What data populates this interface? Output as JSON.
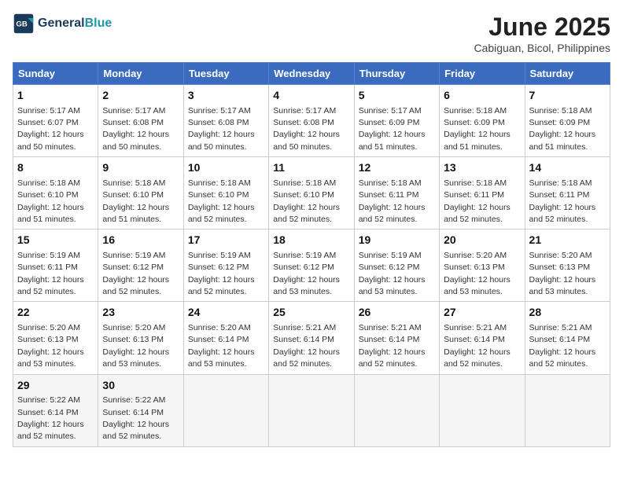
{
  "header": {
    "logo_line1": "General",
    "logo_line2": "Blue",
    "month_year": "June 2025",
    "location": "Cabiguan, Bicol, Philippines"
  },
  "weekdays": [
    "Sunday",
    "Monday",
    "Tuesday",
    "Wednesday",
    "Thursday",
    "Friday",
    "Saturday"
  ],
  "weeks": [
    [
      {
        "day": 1,
        "sunrise": "5:17 AM",
        "sunset": "6:07 PM",
        "daylight": "12 hours and 50 minutes."
      },
      {
        "day": 2,
        "sunrise": "5:17 AM",
        "sunset": "6:08 PM",
        "daylight": "12 hours and 50 minutes."
      },
      {
        "day": 3,
        "sunrise": "5:17 AM",
        "sunset": "6:08 PM",
        "daylight": "12 hours and 50 minutes."
      },
      {
        "day": 4,
        "sunrise": "5:17 AM",
        "sunset": "6:08 PM",
        "daylight": "12 hours and 50 minutes."
      },
      {
        "day": 5,
        "sunrise": "5:17 AM",
        "sunset": "6:09 PM",
        "daylight": "12 hours and 51 minutes."
      },
      {
        "day": 6,
        "sunrise": "5:18 AM",
        "sunset": "6:09 PM",
        "daylight": "12 hours and 51 minutes."
      },
      {
        "day": 7,
        "sunrise": "5:18 AM",
        "sunset": "6:09 PM",
        "daylight": "12 hours and 51 minutes."
      }
    ],
    [
      {
        "day": 8,
        "sunrise": "5:18 AM",
        "sunset": "6:10 PM",
        "daylight": "12 hours and 51 minutes."
      },
      {
        "day": 9,
        "sunrise": "5:18 AM",
        "sunset": "6:10 PM",
        "daylight": "12 hours and 51 minutes."
      },
      {
        "day": 10,
        "sunrise": "5:18 AM",
        "sunset": "6:10 PM",
        "daylight": "12 hours and 52 minutes."
      },
      {
        "day": 11,
        "sunrise": "5:18 AM",
        "sunset": "6:10 PM",
        "daylight": "12 hours and 52 minutes."
      },
      {
        "day": 12,
        "sunrise": "5:18 AM",
        "sunset": "6:11 PM",
        "daylight": "12 hours and 52 minutes."
      },
      {
        "day": 13,
        "sunrise": "5:18 AM",
        "sunset": "6:11 PM",
        "daylight": "12 hours and 52 minutes."
      },
      {
        "day": 14,
        "sunrise": "5:18 AM",
        "sunset": "6:11 PM",
        "daylight": "12 hours and 52 minutes."
      }
    ],
    [
      {
        "day": 15,
        "sunrise": "5:19 AM",
        "sunset": "6:11 PM",
        "daylight": "12 hours and 52 minutes."
      },
      {
        "day": 16,
        "sunrise": "5:19 AM",
        "sunset": "6:12 PM",
        "daylight": "12 hours and 52 minutes."
      },
      {
        "day": 17,
        "sunrise": "5:19 AM",
        "sunset": "6:12 PM",
        "daylight": "12 hours and 52 minutes."
      },
      {
        "day": 18,
        "sunrise": "5:19 AM",
        "sunset": "6:12 PM",
        "daylight": "12 hours and 53 minutes."
      },
      {
        "day": 19,
        "sunrise": "5:19 AM",
        "sunset": "6:12 PM",
        "daylight": "12 hours and 53 minutes."
      },
      {
        "day": 20,
        "sunrise": "5:20 AM",
        "sunset": "6:13 PM",
        "daylight": "12 hours and 53 minutes."
      },
      {
        "day": 21,
        "sunrise": "5:20 AM",
        "sunset": "6:13 PM",
        "daylight": "12 hours and 53 minutes."
      }
    ],
    [
      {
        "day": 22,
        "sunrise": "5:20 AM",
        "sunset": "6:13 PM",
        "daylight": "12 hours and 53 minutes."
      },
      {
        "day": 23,
        "sunrise": "5:20 AM",
        "sunset": "6:13 PM",
        "daylight": "12 hours and 53 minutes."
      },
      {
        "day": 24,
        "sunrise": "5:20 AM",
        "sunset": "6:14 PM",
        "daylight": "12 hours and 53 minutes."
      },
      {
        "day": 25,
        "sunrise": "5:21 AM",
        "sunset": "6:14 PM",
        "daylight": "12 hours and 52 minutes."
      },
      {
        "day": 26,
        "sunrise": "5:21 AM",
        "sunset": "6:14 PM",
        "daylight": "12 hours and 52 minutes."
      },
      {
        "day": 27,
        "sunrise": "5:21 AM",
        "sunset": "6:14 PM",
        "daylight": "12 hours and 52 minutes."
      },
      {
        "day": 28,
        "sunrise": "5:21 AM",
        "sunset": "6:14 PM",
        "daylight": "12 hours and 52 minutes."
      }
    ],
    [
      {
        "day": 29,
        "sunrise": "5:22 AM",
        "sunset": "6:14 PM",
        "daylight": "12 hours and 52 minutes."
      },
      {
        "day": 30,
        "sunrise": "5:22 AM",
        "sunset": "6:14 PM",
        "daylight": "12 hours and 52 minutes."
      },
      null,
      null,
      null,
      null,
      null
    ]
  ]
}
